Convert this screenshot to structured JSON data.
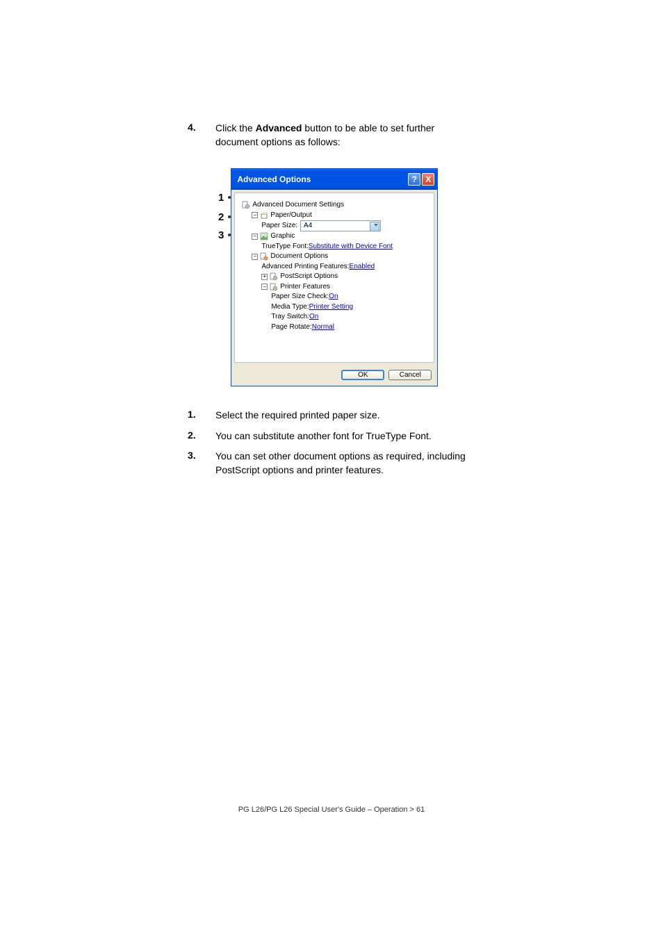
{
  "main_step": {
    "num": "4.",
    "text_prefix": "Click the ",
    "text_bold": "Advanced",
    "text_suffix": " button to be able to set further document options as follows:"
  },
  "callouts": {
    "c1": "1",
    "c2": "2",
    "c3": "3"
  },
  "dialog": {
    "title": "Advanced Options",
    "help_label": "?",
    "close_label": "X",
    "tree": {
      "root": "Advanced Document Settings",
      "paper_output": "Paper/Output",
      "paper_size_label": "Paper Size:",
      "paper_size_value": "A4",
      "graphic": "Graphic",
      "truetype_label": "TrueType Font: ",
      "truetype_value": "Substitute with Device Font",
      "doc_options": "Document Options",
      "adv_print_label": "Advanced Printing Features: ",
      "adv_print_value": "Enabled",
      "postscript": "PostScript Options",
      "printer_features": "Printer Features",
      "paper_check_label": "Paper Size Check: ",
      "paper_check_value": "On",
      "media_type_label": "Media Type: ",
      "media_type_value": "Printer Setting",
      "tray_switch_label": "Tray Switch: ",
      "tray_switch_value": "On",
      "page_rotate_label": "Page Rotate: ",
      "page_rotate_value": "Normal"
    },
    "ok": "OK",
    "cancel": "Cancel"
  },
  "sub_steps": {
    "s1_num": "1.",
    "s1_text": "Select the required printed paper size.",
    "s2_num": "2.",
    "s2_text": "You can substitute another font for TrueType Font.",
    "s3_num": "3.",
    "s3_text": "You can set other document options as required, including PostScript options and printer features."
  },
  "footer": "PG L26/PG L26 Special User's Guide – Operation > 61"
}
